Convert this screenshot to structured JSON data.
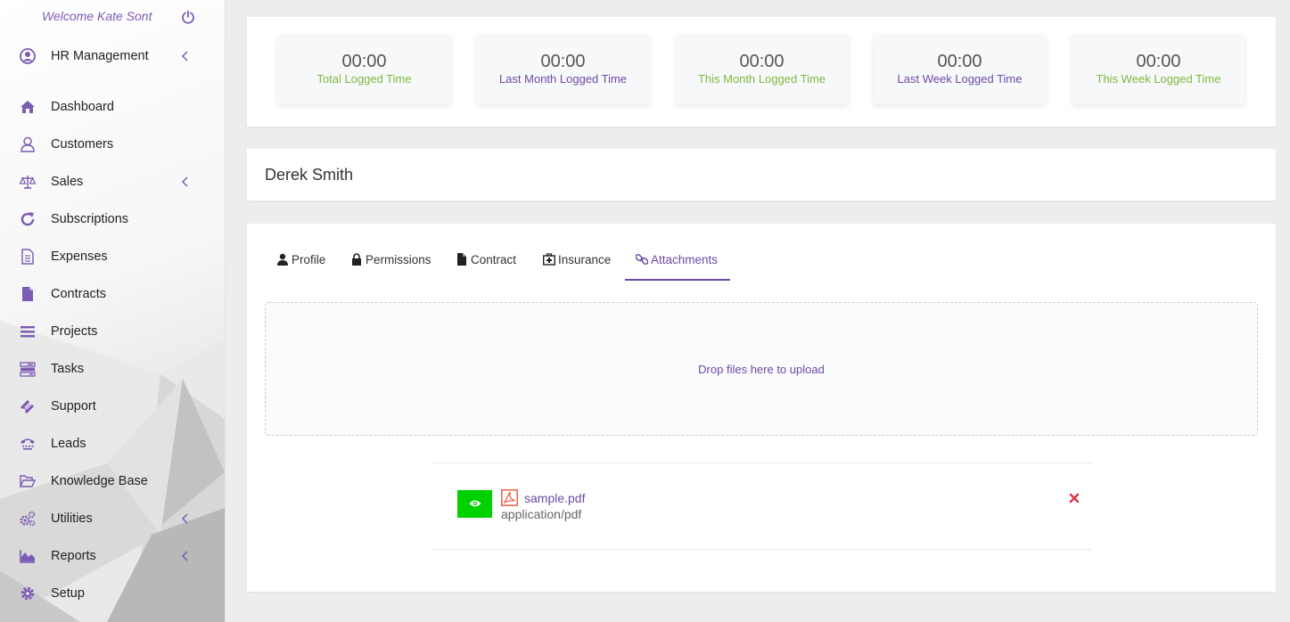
{
  "sidebar": {
    "welcome": "Welcome Kate Sont",
    "items": [
      {
        "label": "HR Management",
        "icon": "user-circle-icon",
        "chevron": true
      },
      {
        "label": "Dashboard",
        "icon": "home-icon",
        "chevron": false
      },
      {
        "label": "Customers",
        "icon": "user-icon",
        "chevron": false
      },
      {
        "label": "Sales",
        "icon": "balance-scale-icon",
        "chevron": true
      },
      {
        "label": "Subscriptions",
        "icon": "refresh-icon",
        "chevron": false
      },
      {
        "label": "Expenses",
        "icon": "file-text-icon",
        "chevron": false
      },
      {
        "label": "Contracts",
        "icon": "file-icon",
        "chevron": false
      },
      {
        "label": "Projects",
        "icon": "bars-icon",
        "chevron": false
      },
      {
        "label": "Tasks",
        "icon": "tasks-icon",
        "chevron": false
      },
      {
        "label": "Support",
        "icon": "ticket-icon",
        "chevron": false
      },
      {
        "label": "Leads",
        "icon": "tty-icon",
        "chevron": false
      },
      {
        "label": "Knowledge Base",
        "icon": "folder-open-icon",
        "chevron": false
      },
      {
        "label": "Utilities",
        "icon": "cogs-icon",
        "chevron": true
      },
      {
        "label": "Reports",
        "icon": "area-chart-icon",
        "chevron": true
      },
      {
        "label": "Setup",
        "icon": "gear-icon",
        "chevron": false
      }
    ]
  },
  "stats": [
    {
      "value": "00:00",
      "label": "Total Logged Time",
      "color": "green"
    },
    {
      "value": "00:00",
      "label": "Last Month Logged Time",
      "color": "purple"
    },
    {
      "value": "00:00",
      "label": "This Month Logged Time",
      "color": "green"
    },
    {
      "value": "00:00",
      "label": "Last Week Logged Time",
      "color": "purple"
    },
    {
      "value": "00:00",
      "label": "This Week Logged Time",
      "color": "green"
    }
  ],
  "staff": {
    "name": "Derek Smith"
  },
  "tabs": [
    {
      "label": "Profile",
      "icon": "user-icon"
    },
    {
      "label": "Permissions",
      "icon": "lock-icon"
    },
    {
      "label": "Contract",
      "icon": "file-icon"
    },
    {
      "label": "Insurance",
      "icon": "medkit-icon"
    },
    {
      "label": "Attachments",
      "icon": "link-icon",
      "active": true
    }
  ],
  "dropzone": {
    "text": "Drop files here to upload"
  },
  "attachment": {
    "name": "sample.pdf",
    "type": "application/pdf"
  },
  "colors": {
    "accent": "#6c4aa6",
    "green": "#7cba3c",
    "view_button": "#00d100",
    "delete": "#e0354b",
    "pdf": "#e8553e"
  }
}
